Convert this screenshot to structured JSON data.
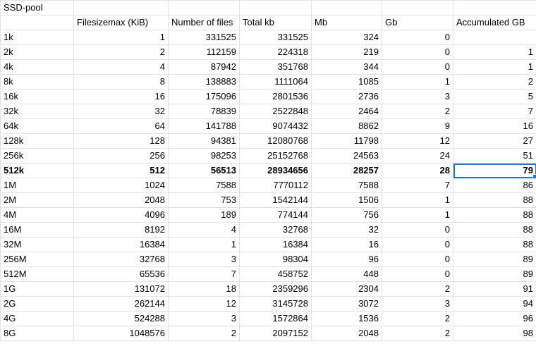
{
  "sheet_title": "SSD-pool",
  "headers": [
    "",
    "Filesizemax (KiB)",
    "Number of files",
    "Total kb",
    "Mb",
    "Gb",
    "Accumulated GB"
  ],
  "rows": [
    [
      "1k",
      "1",
      "331525",
      "331525",
      "324",
      "0",
      ""
    ],
    [
      "2k",
      "2",
      "112159",
      "224318",
      "219",
      "0",
      "1"
    ],
    [
      "4k",
      "4",
      "87942",
      "351768",
      "344",
      "0",
      "1"
    ],
    [
      "8k",
      "8",
      "138883",
      "1111064",
      "1085",
      "1",
      "2"
    ],
    [
      "16k",
      "16",
      "175096",
      "2801536",
      "2736",
      "3",
      "5"
    ],
    [
      "32k",
      "32",
      "78839",
      "2522848",
      "2464",
      "2",
      "7"
    ],
    [
      "64k",
      "64",
      "141788",
      "9074432",
      "8862",
      "9",
      "16"
    ],
    [
      "128k",
      "128",
      "94381",
      "12080768",
      "11798",
      "12",
      "27"
    ],
    [
      "256k",
      "256",
      "98253",
      "25152768",
      "24563",
      "24",
      "51"
    ],
    [
      "512k",
      "512",
      "56513",
      "28934656",
      "28257",
      "28",
      "79"
    ],
    [
      "1M",
      "1024",
      "7588",
      "7770112",
      "7588",
      "7",
      "86"
    ],
    [
      "2M",
      "2048",
      "753",
      "1542144",
      "1506",
      "1",
      "88"
    ],
    [
      "4M",
      "4096",
      "189",
      "774144",
      "756",
      "1",
      "88"
    ],
    [
      "16M",
      "8192",
      "4",
      "32768",
      "32",
      "0",
      "88"
    ],
    [
      "32M",
      "16384",
      "1",
      "16384",
      "16",
      "0",
      "88"
    ],
    [
      "256M",
      "32768",
      "3",
      "98304",
      "96",
      "0",
      "89"
    ],
    [
      "512M",
      "65536",
      "7",
      "458752",
      "448",
      "0",
      "89"
    ],
    [
      "1G",
      "131072",
      "18",
      "2359296",
      "2304",
      "2",
      "91"
    ],
    [
      "2G",
      "262144",
      "12",
      "3145728",
      "3072",
      "3",
      "94"
    ],
    [
      "4G",
      "524288",
      "3",
      "1572864",
      "1536",
      "2",
      "96"
    ],
    [
      "8G",
      "1048576",
      "2",
      "2097152",
      "2048",
      "2",
      "98"
    ]
  ],
  "bold_row_index": 9,
  "selected_cell": {
    "row": 9,
    "col": 6
  },
  "colors": {
    "selection": "#1a73e8",
    "gridline": "#e2e2e2"
  }
}
